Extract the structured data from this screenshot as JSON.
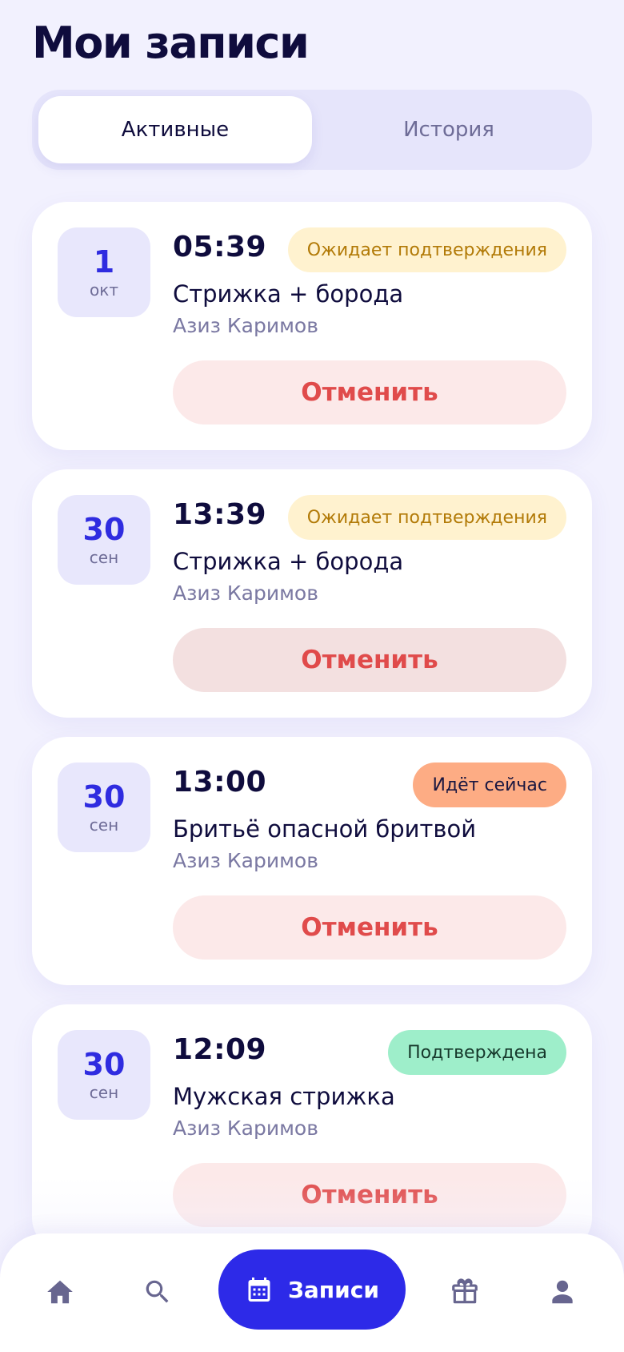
{
  "header": {
    "title": "Мои записи"
  },
  "tabs": {
    "active": "Активные",
    "history": "История"
  },
  "appointments": [
    {
      "day": "1",
      "month": "окт",
      "time": "05:39",
      "status": "Ожидает подтверждения",
      "status_type": "pending",
      "service": "Стрижка + борода",
      "master": "Азиз Каримов",
      "cancel_label": "Отменить"
    },
    {
      "day": "30",
      "month": "сен",
      "time": "13:39",
      "status": "Ожидает подтверждения",
      "status_type": "pending",
      "service": "Стрижка + борода",
      "master": "Азиз Каримов",
      "cancel_label": "Отменить"
    },
    {
      "day": "30",
      "month": "сен",
      "time": "13:00",
      "status": "Идёт сейчас",
      "status_type": "now",
      "service": "Бритьё опасной бритвой",
      "master": "Азиз Каримов",
      "cancel_label": "Отменить"
    },
    {
      "day": "30",
      "month": "сен",
      "time": "12:09",
      "status": "Подтверждена",
      "status_type": "confirmed",
      "service": "Мужская стрижка",
      "master": "Азиз Каримов",
      "cancel_label": "Отменить"
    }
  ],
  "nav": {
    "items": [
      {
        "icon": "home-icon"
      },
      {
        "icon": "search-icon"
      },
      {
        "icon": "calendar-icon",
        "label": "Записи",
        "active": true
      },
      {
        "icon": "gift-icon"
      },
      {
        "icon": "profile-icon"
      }
    ]
  },
  "colors": {
    "accent": "#2d2ae8",
    "background": "#f2f1fe",
    "cancel_text": "#e04b4b",
    "pending_bg": "#fff2cf",
    "now_bg": "#fdac84",
    "confirmed_bg": "#9eeeca"
  }
}
